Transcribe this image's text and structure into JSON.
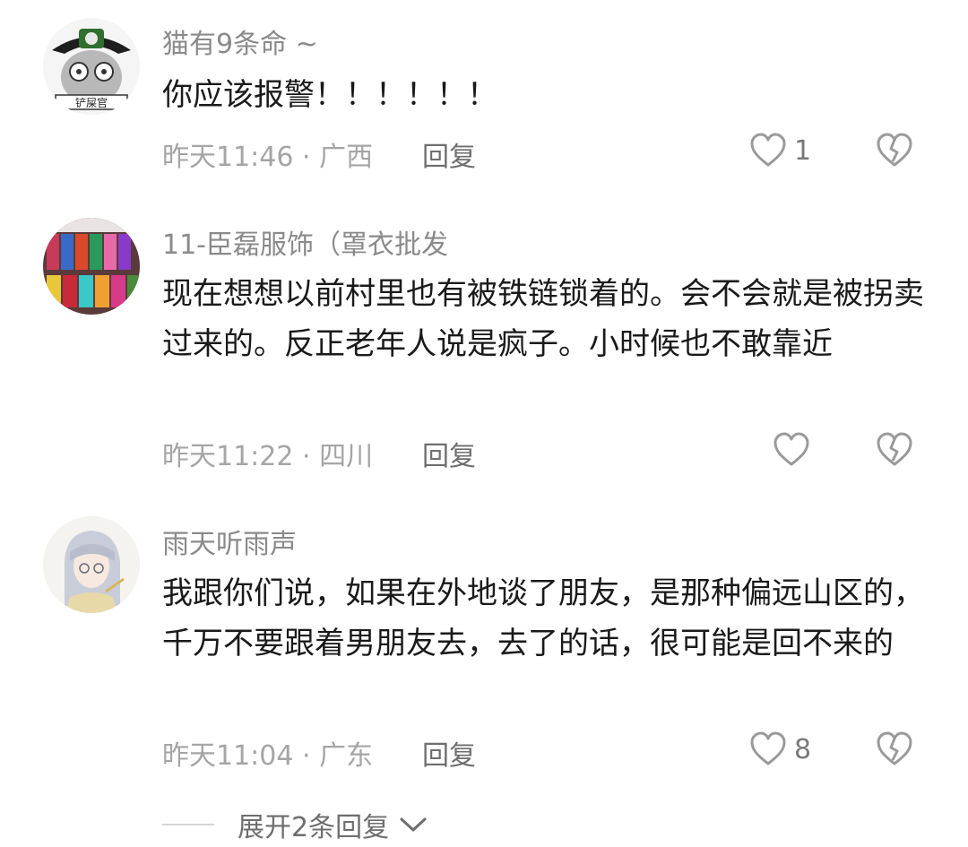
{
  "comments": [
    {
      "username": "猫有9条命 ~",
      "text": "你应该报警！！！！！！",
      "time_location": "昨天11:46 · 广西",
      "reply_label": "回复",
      "like_count": "1",
      "avatar_caption": "铲屎官"
    },
    {
      "username": "11-臣磊服饰（罩衣批发",
      "text": "现在想想以前村里也有被铁链锁着的。会不会就是被拐卖过来的。反正老年人说是疯子。小时候也不敢靠近",
      "time_location": "昨天11:22 · 四川",
      "reply_label": "回复",
      "like_count": ""
    },
    {
      "username": "雨天听雨声",
      "text": "我跟你们说，如果在外地谈了朋友，是那种偏远山区的，千万不要跟着男朋友去，去了的话，很可能是回不来的",
      "time_location": "昨天11:04 · 广东",
      "reply_label": "回复",
      "like_count": "8"
    }
  ],
  "expand": {
    "label": "展开2条回复"
  },
  "icons": {
    "like": "heart-outline-icon",
    "dislike": "broken-heart-icon",
    "expand": "chevron-down-icon"
  },
  "colors": {
    "username": "#8a8a8a",
    "body_text": "#1a1a1a",
    "meta": "#a5a5a5",
    "icon": "#9a9a9a"
  }
}
